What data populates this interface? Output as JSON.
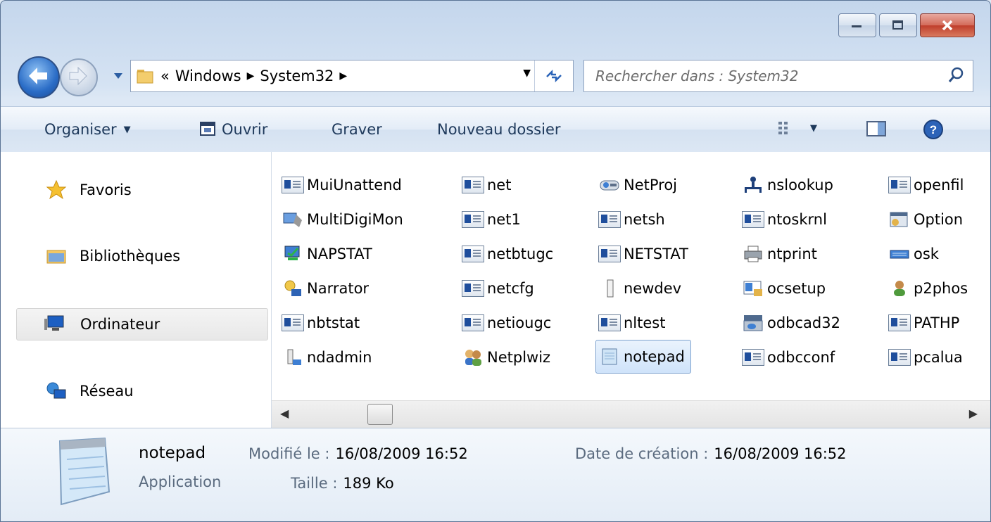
{
  "window": {
    "caption_buttons": [
      "minimize",
      "maximize",
      "close"
    ]
  },
  "address_bar": {
    "overflow": "«",
    "crumbs": [
      "Windows",
      "System32"
    ]
  },
  "search": {
    "placeholder": "Rechercher dans : System32"
  },
  "command_bar": {
    "organize": "Organiser",
    "open": "Ouvrir",
    "burn": "Graver",
    "new_folder": "Nouveau dossier"
  },
  "nav_pane": {
    "favorites": "Favoris",
    "libraries": "Bibliothèques",
    "computer": "Ordinateur",
    "network": "Réseau"
  },
  "files": {
    "col1": [
      "MuiUnattend",
      "MultiDigiMon",
      "NAPSTAT",
      "Narrator",
      "nbtstat",
      "ndadmin"
    ],
    "col2": [
      "net",
      "net1",
      "netbtugc",
      "netcfg",
      "netiougc",
      "Netplwiz"
    ],
    "col3": [
      "NetProj",
      "netsh",
      "NETSTAT",
      "newdev",
      "nltest",
      "notepad"
    ],
    "col4": [
      "nslookup",
      "ntoskrnl",
      "ntprint",
      "ocsetup",
      "odbcad32",
      "odbcconf"
    ],
    "col5": [
      "openfil",
      "Option",
      "osk",
      "p2phos",
      "PATHP",
      "pcalua"
    ]
  },
  "details": {
    "name": "notepad",
    "type": "Application",
    "modified_label": "Modifié le :",
    "modified_value": "16/08/2009 16:52",
    "created_label": "Date de création :",
    "created_value": "16/08/2009 16:52",
    "size_label": "Taille :",
    "size_value": "189 Ko"
  },
  "colors": {
    "selection_border": "#7da2ce",
    "accent": "#1e395b"
  }
}
